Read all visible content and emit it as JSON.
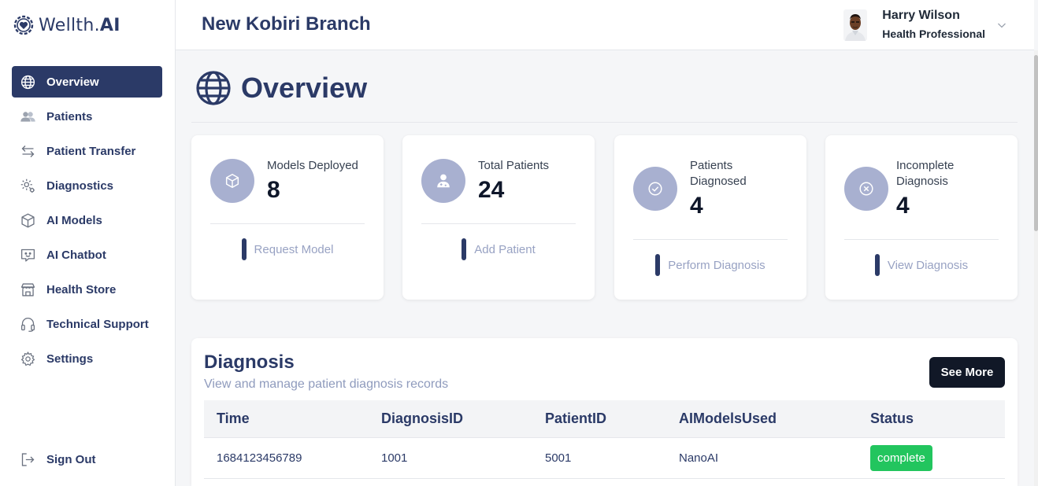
{
  "app": {
    "logo_text_regular": "Wellth.",
    "logo_text_bold": "AI"
  },
  "sidebar": {
    "items": [
      {
        "label": "Overview",
        "icon": "globe-icon",
        "active": true
      },
      {
        "label": "Patients",
        "icon": "users-icon"
      },
      {
        "label": "Patient Transfer",
        "icon": "transfer-arrows-icon"
      },
      {
        "label": "Diagnostics",
        "icon": "gear-cog-icon"
      },
      {
        "label": "AI Models",
        "icon": "cube-icon"
      },
      {
        "label": "AI Chatbot",
        "icon": "chat-bot-icon"
      },
      {
        "label": "Health Store",
        "icon": "store-icon"
      },
      {
        "label": "Technical Support",
        "icon": "headset-icon"
      },
      {
        "label": "Settings",
        "icon": "settings-icon"
      }
    ],
    "signout": {
      "label": "Sign Out",
      "icon": "sign-out-icon"
    }
  },
  "header": {
    "branch": "New Kobiri Branch",
    "user_name": "Harry Wilson",
    "user_role": "Health Professional"
  },
  "main": {
    "title": "Overview"
  },
  "cards": [
    {
      "label": "Models Deployed",
      "value": "8",
      "action": "Request Model",
      "icon": "cube-icon"
    },
    {
      "label": "Total Patients",
      "value": "24",
      "action": "Add Patient",
      "icon": "doctor-icon"
    },
    {
      "label": "Patients Diagnosed",
      "value": "4",
      "action": "Perform Diagnosis",
      "icon": "check-circle-icon"
    },
    {
      "label": "Incomplete Diagnosis",
      "value": "4",
      "action": "View Diagnosis",
      "icon": "x-circle-icon"
    }
  ],
  "diagnosis": {
    "title": "Diagnosis",
    "subtitle": "View and manage patient diagnosis records",
    "see_more": "See More",
    "columns": [
      "Time",
      "DiagnosisID",
      "PatientID",
      "AIModelsUsed",
      "Status"
    ],
    "rows": [
      {
        "time": "1684123456789",
        "diagnosis_id": "1001",
        "patient_id": "5001",
        "models": "NanoAI",
        "status": "complete"
      }
    ]
  },
  "colors": {
    "primary": "#2b3a67",
    "accent_soft": "#a8b0d0",
    "status_complete": "#22c55e",
    "button_dark": "#111827"
  }
}
